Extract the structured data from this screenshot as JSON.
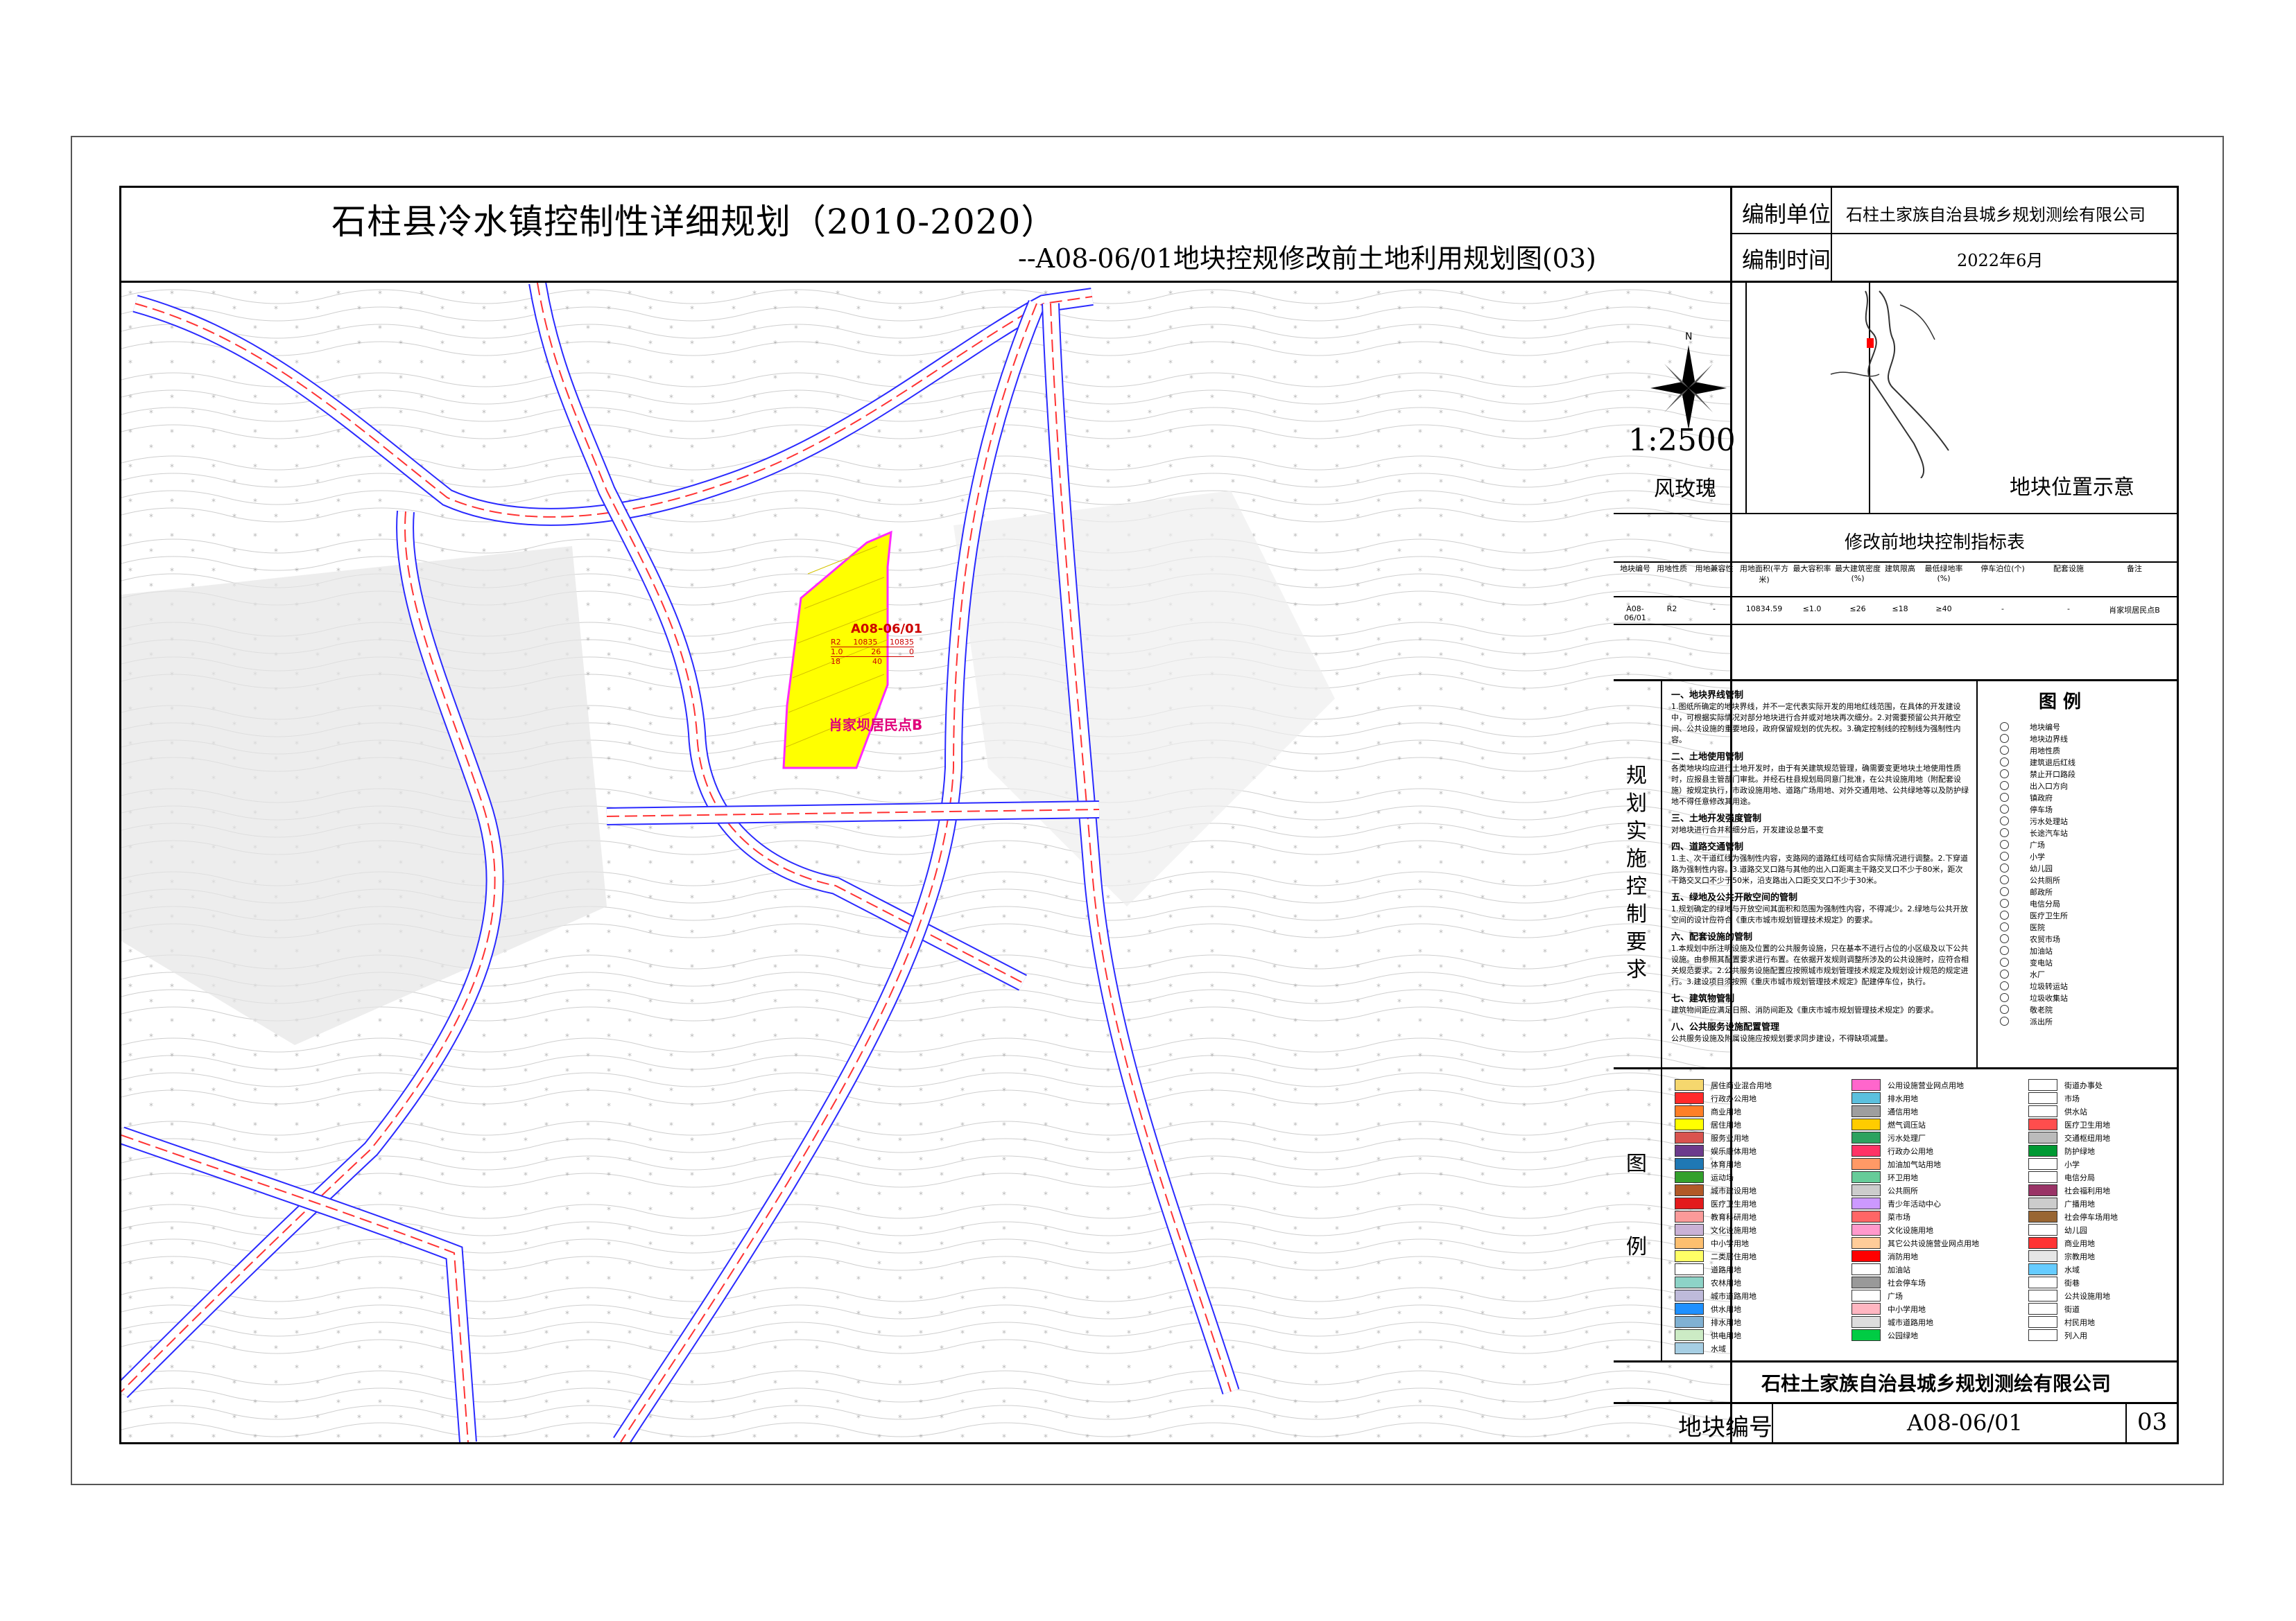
{
  "title": "石柱县冷水镇控制性详细规划（2010-2020）",
  "subtitle": "--A08-06/01地块控规修改前土地利用规划图(03)",
  "info": {
    "unit_label": "编制单位",
    "unit_value": "石柱土家族自治县城乡规划测绘有限公司",
    "time_label": "编制时间",
    "time_value": "2022年6月"
  },
  "north": {
    "letter": "N",
    "scale": "1:2500",
    "label": "风玫瑰"
  },
  "location_label": "地块位置示意",
  "control_table": {
    "title": "修改前地块控制指标表",
    "headers": [
      "地块编号",
      "用地性质",
      "用地兼容性",
      "用地面积(平方米)",
      "最大容积率",
      "最大建筑密度(%)",
      "建筑限高",
      "最低绿地率(%)",
      "停车泊位(个)",
      "配套设施",
      "备注"
    ],
    "row": [
      "A08-06/01",
      "R2",
      "-",
      "10834.59",
      "≤1.0",
      "≤26",
      "≤18",
      "≥40",
      "-",
      "-",
      "肖家坝居民点B"
    ]
  },
  "requirements": {
    "side_title": "规划实施控制要求",
    "sections": [
      {
        "h": "一、地块界线管制",
        "t": "1.图纸所确定的地块界线，并不一定代表实际开发的用地红线范围，在具体的开发建设中，可根据实际情况对部分地块进行合并或对地块再次细分。2.对需要预留公共开敞空间、公共设施的重要地段，政府保留规划的优先权。3.确定控制线的控制线为强制性内容。"
      },
      {
        "h": "二、土地使用管制",
        "t": "各类地块均应进行土地开发时，由于有关建筑规范管理，确需要变更地块土地使用性质时，应报县主管部门审批。并经石柱县规划局同意门批准，在公共设施用地（附配套设施）按规定执行，市政设施用地、道路广场用地、对外交通用地、公共绿地等以及防护绿地不得任意修改其用途。"
      },
      {
        "h": "三、土地开发强度管制",
        "t": "对地块进行合并和细分后，开发建设总量不变"
      },
      {
        "h": "四、道路交通管制",
        "t": "1.主、次干道红线为强制性内容，支路网的道路红线可结合实际情况进行调整。2.下穿道路为强制性内容。3.道路交叉口路与其他的出入口距离主干路交叉口不少于80米，距次干路交叉口不少于50米，沿支路出入口距交叉口不少于30米。"
      },
      {
        "h": "五、绿地及公共开敞空间的管制",
        "t": "1.规划确定的绿地与开放空间其面积和范围为强制性内容，不得减少。2.绿地与公共开放空间的设计应符合《重庆市城市规划管理技术规定》的要求。"
      },
      {
        "h": "六、配套设施的管制",
        "t": "1.本规划中所注明设施及位置的公共服务设施，只在基本不进行占位的小区级及以下公共设施。由参照其配置要求进行布置。在依据开发规则调整所涉及的公共设施时，应符合相关规范要求。2.公共服务设施配置应按照城市规划管理技术规定及规划设计规范的规定进行。3.建设项目须按照《重庆市城市规划管理技术规定》配建停车位，执行。"
      },
      {
        "h": "七、建筑物管制",
        "t": "建筑物间距应满足日照、消防间距及《重庆市城市规划管理技术规定》的要求。"
      },
      {
        "h": "八、公共服务设施配置管理",
        "t": "公共服务设施及附属设施应按规划要求同步建设，不得缺项减量。"
      }
    ]
  },
  "legend_top": {
    "title": "图 例",
    "items": [
      "地块编号",
      "地块边界线",
      "用地性质",
      "建筑退后红线",
      "禁止开口路段",
      "出入口方向",
      "镇政府",
      "停车场",
      "污水处理站",
      "长途汽车站",
      "广场",
      "小学",
      "幼儿园",
      "公共厕所",
      "邮政所",
      "电信分局",
      "医疗卫生所",
      "医院",
      "农贸市场",
      "加油站",
      "变电站",
      "水厂",
      "垃圾转运站",
      "垃圾收集站",
      "敬老院",
      "派出所"
    ]
  },
  "legend_bottom": {
    "side_title": "图例",
    "col1": [
      {
        "label": "居住商业混合用地",
        "color": "#f5d76e"
      },
      {
        "label": "行政办公用地",
        "color": "#ff2a2a"
      },
      {
        "label": "商业用地",
        "color": "#ff7f27"
      },
      {
        "label": "居住用地",
        "color": "#ffff00"
      },
      {
        "label": "服务业用地",
        "color": "#d9534f"
      },
      {
        "label": "娱乐康体用地",
        "color": "#6c3b8c"
      },
      {
        "label": "体育用地",
        "color": "#1f78b4"
      },
      {
        "label": "运动场",
        "color": "#33a02c"
      },
      {
        "label": "城市建设用地",
        "color": "#b15928"
      },
      {
        "label": "医疗卫生用地",
        "color": "#e31a1c"
      },
      {
        "label": "教育科研用地",
        "color": "#fb9a99"
      },
      {
        "label": "文化设施用地",
        "color": "#cab2d6"
      },
      {
        "label": "中小学用地",
        "color": "#fdbf6f"
      },
      {
        "label": "二类居住用地",
        "color": "#ffff66"
      },
      {
        "label": "道路用地",
        "color": "#ffffff"
      },
      {
        "label": "农林用地",
        "color": "#8dd3c7"
      },
      {
        "label": "城市道路用地",
        "color": "#bebada"
      },
      {
        "label": "供水用地",
        "color": "#1e90ff"
      },
      {
        "label": "排水用地",
        "color": "#80b1d3"
      },
      {
        "label": "供电用地",
        "color": "#ccebc5"
      },
      {
        "label": "水域",
        "color": "#a6cee3"
      }
    ],
    "col2": [
      {
        "label": "公用设施营业网点用地",
        "color": "#ff66cc"
      },
      {
        "label": "排水用地",
        "color": "#5bc0de"
      },
      {
        "label": "通信用地",
        "color": "#9e9e9e"
      },
      {
        "label": "燃气调压站",
        "color": "#ffcc00"
      },
      {
        "label": "污水处理厂",
        "color": "#2ca25f"
      },
      {
        "label": "行政办公用地",
        "color": "#ff3366"
      },
      {
        "label": "加油加气站用地",
        "color": "#ff9966"
      },
      {
        "label": "环卫用地",
        "color": "#66cc99"
      },
      {
        "label": "公共厕所",
        "color": "#cccccc"
      },
      {
        "label": "青少年活动中心",
        "color": "#cc99ff"
      },
      {
        "label": "菜市场",
        "color": "#ff6666"
      },
      {
        "label": "文化设施用地",
        "color": "#ff99cc"
      },
      {
        "label": "其它公共设施营业网点用地",
        "color": "#ffcc99"
      },
      {
        "label": "消防用地",
        "color": "#ff0000"
      },
      {
        "label": "加油站",
        "color": "#ffffff"
      },
      {
        "label": "社会停车场",
        "color": "#999999"
      },
      {
        "label": "广场",
        "color": "#ffffff"
      },
      {
        "label": "中小学用地",
        "color": "#ffb6c1"
      },
      {
        "label": "城市道路用地",
        "color": "#dddddd"
      },
      {
        "label": "公园绿地",
        "color": "#00cc44"
      }
    ],
    "col3": [
      {
        "label": "街道办事处",
        "color": "#ffffff"
      },
      {
        "label": "市场",
        "color": "#ffffff"
      },
      {
        "label": "供水站",
        "color": "#ffffff"
      },
      {
        "label": "医疗卫生用地",
        "color": "#ff4d4d"
      },
      {
        "label": "交通枢纽用地",
        "color": "#bbbbbb"
      },
      {
        "label": "防护绿地",
        "color": "#009933"
      },
      {
        "label": "小学",
        "color": "#ffffff"
      },
      {
        "label": "电信分局",
        "color": "#ffffff"
      },
      {
        "label": "社会福利用地",
        "color": "#993366"
      },
      {
        "label": "广播用地",
        "color": "#cccccc"
      },
      {
        "label": "社会停车场用地",
        "color": "#996633"
      },
      {
        "label": "幼儿园",
        "color": "#ffffff"
      },
      {
        "label": "商业用地",
        "color": "#ff3333"
      },
      {
        "label": "宗教用地",
        "color": "#e6e6e6"
      },
      {
        "label": "水域",
        "color": "#66ccff"
      },
      {
        "label": "街巷",
        "color": "#ffffff"
      },
      {
        "label": "公共设施用地",
        "color": "#ffffff"
      },
      {
        "label": "街道",
        "color": "#ffffff"
      },
      {
        "label": "村民用地",
        "color": "#ffffff"
      },
      {
        "label": "列入用",
        "color": "#ffffff"
      }
    ]
  },
  "company": "石柱土家族自治县城乡规划测绘有限公司",
  "parcel_label": "地块编号",
  "parcel_value": "A08-06/01",
  "sheet_no": "03",
  "map": {
    "parcel_id": "A08-06/01",
    "parcel_row1": [
      "R2",
      "10835",
      "10835"
    ],
    "parcel_row2": [
      "1.0",
      "26",
      "0"
    ],
    "parcel_row3": [
      "18",
      "40",
      ""
    ],
    "parcel_name": "肖家坝居民点B",
    "parcel_color": "#ffff00",
    "road_color": "#2a2aff",
    "centerline_color": "#ff3333"
  }
}
